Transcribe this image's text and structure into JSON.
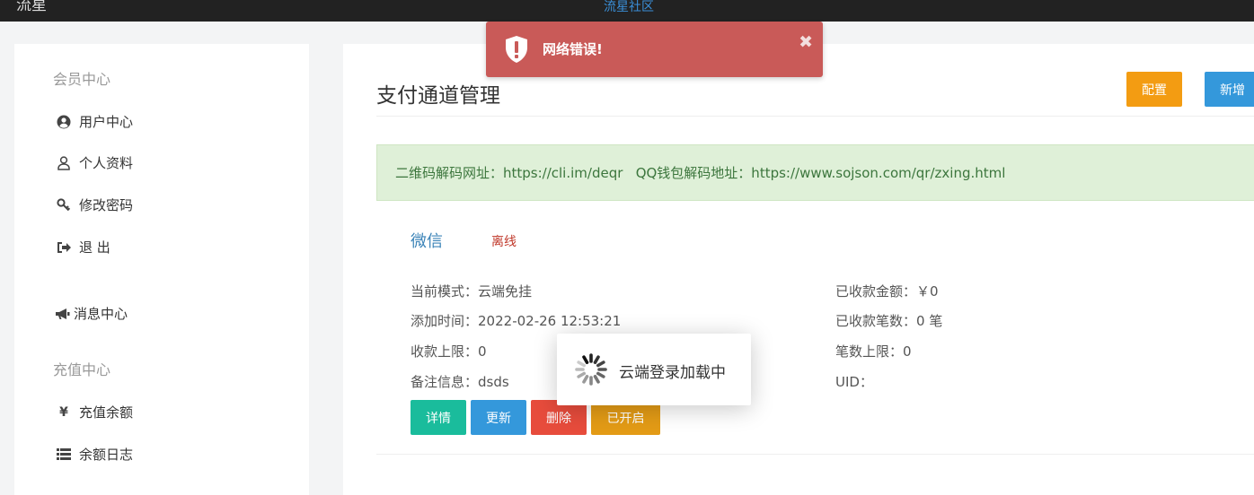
{
  "topbar": {
    "logo_fragment": "流星",
    "site_name": "流星社区"
  },
  "sidebar": {
    "section1": "会员中心",
    "items1": [
      {
        "icon": "user-circle-icon",
        "label": "用户中心"
      },
      {
        "icon": "user-icon",
        "label": "个人资料"
      },
      {
        "icon": "key-icon",
        "label": "修改密码"
      },
      {
        "icon": "sign-out-icon",
        "label": "退 出"
      }
    ],
    "message_item": {
      "icon": "megaphone-icon",
      "label": "消息中心"
    },
    "section2": "充值中心",
    "items2": [
      {
        "icon": "yen-icon",
        "label": "充值余额"
      },
      {
        "icon": "list-icon",
        "label": "余额日志"
      }
    ]
  },
  "main": {
    "title": "支付通道管理",
    "config_button": "配置",
    "new_button": "新增",
    "alert_text": "二维码解码网址：https://cli.im/deqr   QQ钱包解码地址：https://www.sojson.com/qr/zxing.html",
    "channel": {
      "name": "微信",
      "status": "离线",
      "left_fields": [
        {
          "key": "当前模式：",
          "value": "云端免挂"
        },
        {
          "key": "添加时间：",
          "value": "2022-02-26 12:53:21"
        },
        {
          "key": "收款上限：",
          "value": "0"
        },
        {
          "key": "备注信息：",
          "value": "dsds"
        }
      ],
      "right_fields": [
        {
          "key": "已收款金额：",
          "value": "￥0"
        },
        {
          "key": "已收款笔数：",
          "value": "0 笔"
        },
        {
          "key": "笔数上限：",
          "value": "0"
        },
        {
          "key": "UID：",
          "value": ""
        }
      ],
      "actions": {
        "detail": "详情",
        "update": "更新",
        "delete": "删除",
        "enabled": "已开启"
      }
    }
  },
  "toast": {
    "message": "网络错误!",
    "close": "✖"
  },
  "loading": {
    "text": "云端登录加载中"
  },
  "colors": {
    "toast_bg": "#c95a58",
    "alert_bg": "#dff0d8",
    "config": "#f39c12",
    "primary": "#3498db",
    "detail": "#1abc9c",
    "delete": "#e74c3c"
  }
}
